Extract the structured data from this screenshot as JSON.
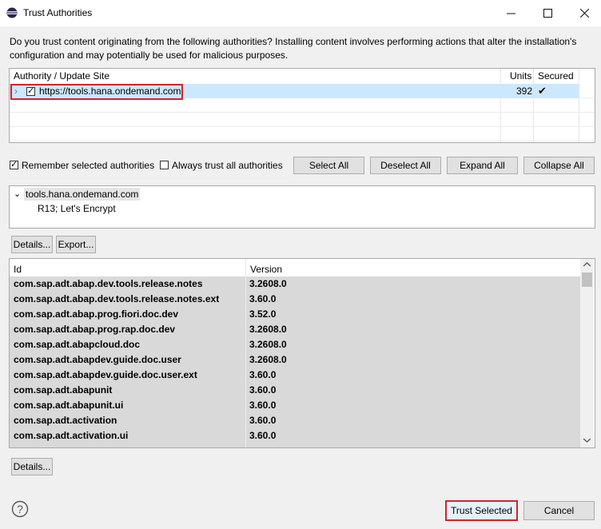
{
  "window": {
    "title": "Trust Authorities"
  },
  "intro": "Do you trust content originating from the following authorities?  Installing content involves performing actions that alter the installation's configuration and may potentially be used for malicious purposes.",
  "authority_table": {
    "headers": {
      "site": "Authority / Update Site",
      "units": "Units",
      "secured": "Secured"
    },
    "rows": [
      {
        "site": "https://tools.hana.ondemand.com",
        "units": "392",
        "secured": "✔"
      }
    ]
  },
  "options": {
    "remember": "Remember selected authorities",
    "always_trust": "Always trust all authorities",
    "select_all": "Select All",
    "deselect_all": "Deselect All",
    "expand_all": "Expand All",
    "collapse_all": "Collapse All"
  },
  "cert_tree": {
    "root": "tools.hana.ondemand.com",
    "child": "R13; Let's Encrypt"
  },
  "detail_buttons": {
    "details": "Details...",
    "export": "Export..."
  },
  "units_table": {
    "headers": {
      "id": "Id",
      "version": "Version"
    },
    "rows": [
      {
        "id": "com.sap.adt.abap.dev.tools.release.notes",
        "version": "3.2608.0"
      },
      {
        "id": "com.sap.adt.abap.dev.tools.release.notes.ext",
        "version": "3.60.0"
      },
      {
        "id": "com.sap.adt.abap.prog.fiori.doc.dev",
        "version": "3.52.0"
      },
      {
        "id": "com.sap.adt.abap.prog.rap.doc.dev",
        "version": "3.2608.0"
      },
      {
        "id": "com.sap.adt.abapcloud.doc",
        "version": "3.2608.0"
      },
      {
        "id": "com.sap.adt.abapdev.guide.doc.user",
        "version": "3.2608.0"
      },
      {
        "id": "com.sap.adt.abapdev.guide.doc.user.ext",
        "version": "3.60.0"
      },
      {
        "id": "com.sap.adt.abapunit",
        "version": "3.60.0"
      },
      {
        "id": "com.sap.adt.abapunit.ui",
        "version": "3.60.0"
      },
      {
        "id": "com.sap.adt.activation",
        "version": "3.60.0"
      },
      {
        "id": "com.sap.adt.activation.ui",
        "version": "3.60.0"
      }
    ]
  },
  "bottom": {
    "details": "Details...",
    "trust_selected": "Trust Selected",
    "cancel": "Cancel"
  },
  "colors": {
    "highlight_border": "#d2232a",
    "selection": "#cce8ff"
  }
}
